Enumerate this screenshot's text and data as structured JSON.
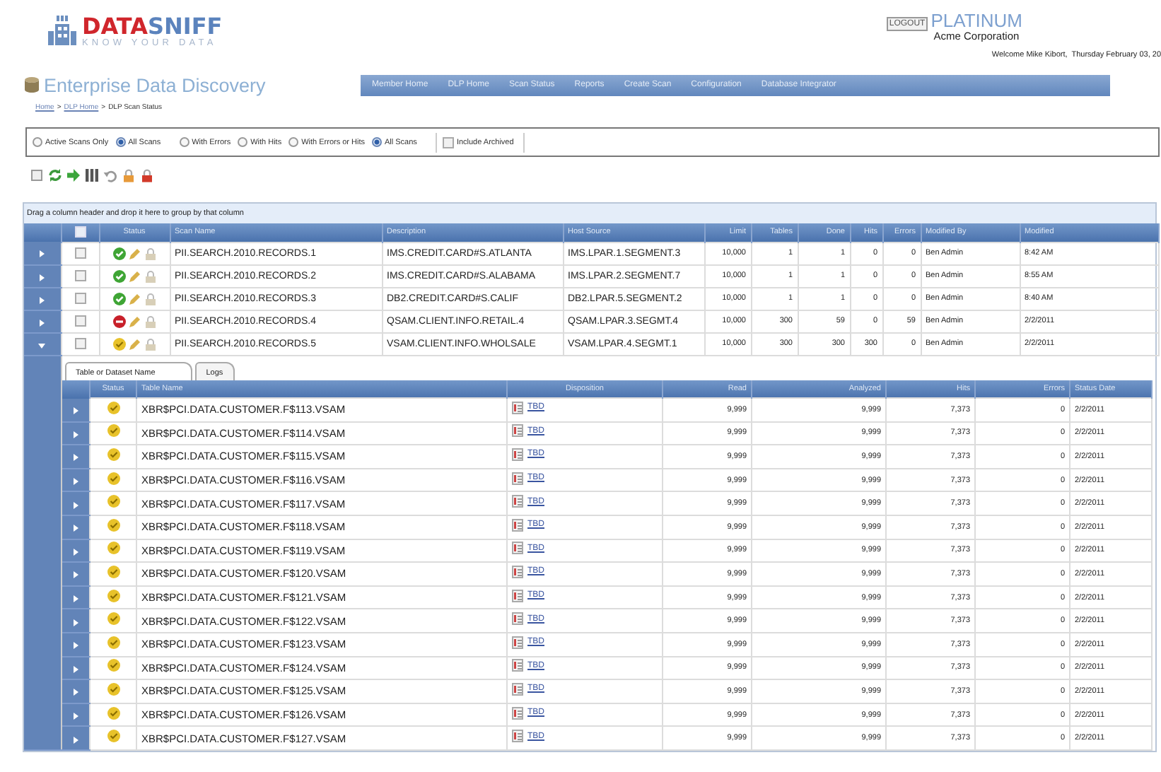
{
  "header": {
    "logo": {
      "word_1": "DATA",
      "word_2": "SNIFF",
      "tagline": "KNOW YOUR DATA"
    },
    "logout": "LOGOUT",
    "plan": "PLATINUM",
    "company": "Acme Corporation",
    "welcome": "Welcome Mike Kibort,  Thursday February 03, 20"
  },
  "app_title": "Enterprise Data Discovery",
  "nav": [
    {
      "label": "Member Home",
      "selected": false
    },
    {
      "label": "DLP Home",
      "selected": false
    },
    {
      "label": "Scan Status",
      "selected": false
    },
    {
      "label": "Reports",
      "selected": false
    },
    {
      "label": "Create Scan",
      "selected": false
    },
    {
      "label": "Configuration",
      "selected": false
    },
    {
      "label": "Database Integrator",
      "selected": false
    }
  ],
  "breadcrumb": [
    {
      "label": "Home",
      "kind": "link"
    },
    {
      "label": ">",
      "kind": "sep"
    },
    {
      "label": "DLP Home",
      "kind": "link"
    },
    {
      "label": ">",
      "kind": "sep"
    },
    {
      "label": "DLP Scan Status",
      "kind": "current"
    }
  ],
  "filters": [
    [
      {
        "label": "Active Scans Only",
        "selected": false
      },
      {
        "label": "All Scans",
        "selected": true
      }
    ],
    [
      {
        "label": "With Errors",
        "selected": false
      },
      {
        "label": "With Hits",
        "selected": false
      },
      {
        "label": "With Errors or Hits",
        "selected": false
      },
      {
        "label": "All Scans",
        "selected": true
      }
    ]
  ],
  "include_archived": {
    "label": "Include Archived",
    "checked": false
  },
  "grid": {
    "group_hint": "Drag a column header and drop it here to group by that column",
    "select_all_checked": false,
    "status_header": "Status",
    "columns": [
      "Scan Name",
      "Description",
      "Host Source",
      "Limit",
      "Tables",
      "Done",
      "Hits",
      "Errors",
      "Modified By",
      "Modified"
    ],
    "rows": [
      {
        "expanded": false,
        "checked": false,
        "kind": "ok",
        "cells": [
          "PII.SEARCH.2010.RECORDS.1",
          "IMS.CREDIT.CARD#S.ATLANTA",
          "IMS.LPAR.1.SEGMENT.3",
          "10,000",
          "1",
          "1",
          "0",
          "0",
          "Ben Admin",
          "8:42 AM"
        ]
      },
      {
        "expanded": false,
        "checked": false,
        "kind": "ok",
        "cells": [
          "PII.SEARCH.2010.RECORDS.2",
          "IMS.CREDIT.CARD#S.ALABAMA",
          "IMS.LPAR.2.SEGMENT.7",
          "10,000",
          "1",
          "1",
          "0",
          "0",
          "Ben Admin",
          "8:55 AM"
        ]
      },
      {
        "expanded": false,
        "checked": false,
        "kind": "ok",
        "cells": [
          "PII.SEARCH.2010.RECORDS.3",
          "DB2.CREDIT.CARD#S.CALIF",
          "DB2.LPAR.5.SEGMENT.2",
          "10,000",
          "1",
          "1",
          "0",
          "0",
          "Ben Admin",
          "8:40 AM"
        ]
      },
      {
        "expanded": false,
        "checked": false,
        "kind": "error",
        "cells": [
          "PII.SEARCH.2010.RECORDS.4",
          "QSAM.CLIENT.INFO.RETAIL.4",
          "QSAM.LPAR.3.SEGMT.4",
          "10,000",
          "300",
          "59",
          "0",
          "59",
          "Ben Admin",
          "2/2/2011"
        ]
      },
      {
        "expanded": true,
        "checked": false,
        "kind": "pending",
        "cells": [
          "PII.SEARCH.2010.RECORDS.5",
          "VSAM.CLIENT.INFO.WHOLSALE",
          "VSAM.LPAR.4.SEGMT.1",
          "10,000",
          "300",
          "300",
          "300",
          "0",
          "Ben Admin",
          "2/2/2011"
        ]
      }
    ]
  },
  "detail": {
    "tabs": [
      {
        "label": "Table or Dataset Name",
        "selected": true
      },
      {
        "label": "Logs",
        "selected": false
      }
    ],
    "status_header": "Status",
    "columns": [
      "Table Name",
      "Disposition",
      "Read",
      "Analyzed",
      "Hits",
      "Errors",
      "Status Date"
    ],
    "rows": [
      {
        "kind": "pending",
        "cells": [
          "XBR$PCI.DATA.CUSTOMER.F$113.VSAM",
          "TBD",
          "9,999",
          "9,999",
          "7,373",
          "0",
          "2/2/2011"
        ]
      },
      {
        "kind": "pending",
        "cells": [
          "XBR$PCI.DATA.CUSTOMER.F$114.VSAM",
          "TBD",
          "9,999",
          "9,999",
          "7,373",
          "0",
          "2/2/2011"
        ]
      },
      {
        "kind": "pending",
        "cells": [
          "XBR$PCI.DATA.CUSTOMER.F$115.VSAM",
          "TBD",
          "9,999",
          "9,999",
          "7,373",
          "0",
          "2/2/2011"
        ]
      },
      {
        "kind": "pending",
        "cells": [
          "XBR$PCI.DATA.CUSTOMER.F$116.VSAM",
          "TBD",
          "9,999",
          "9,999",
          "7,373",
          "0",
          "2/2/2011"
        ]
      },
      {
        "kind": "pending",
        "cells": [
          "XBR$PCI.DATA.CUSTOMER.F$117.VSAM",
          "TBD",
          "9,999",
          "9,999",
          "7,373",
          "0",
          "2/2/2011"
        ]
      },
      {
        "kind": "pending",
        "cells": [
          "XBR$PCI.DATA.CUSTOMER.F$118.VSAM",
          "TBD",
          "9,999",
          "9,999",
          "7,373",
          "0",
          "2/2/2011"
        ]
      },
      {
        "kind": "pending",
        "cells": [
          "XBR$PCI.DATA.CUSTOMER.F$119.VSAM",
          "TBD",
          "9,999",
          "9,999",
          "7,373",
          "0",
          "2/2/2011"
        ]
      },
      {
        "kind": "pending",
        "cells": [
          "XBR$PCI.DATA.CUSTOMER.F$120.VSAM",
          "TBD",
          "9,999",
          "9,999",
          "7,373",
          "0",
          "2/2/2011"
        ]
      },
      {
        "kind": "pending",
        "cells": [
          "XBR$PCI.DATA.CUSTOMER.F$121.VSAM",
          "TBD",
          "9,999",
          "9,999",
          "7,373",
          "0",
          "2/2/2011"
        ]
      },
      {
        "kind": "pending",
        "cells": [
          "XBR$PCI.DATA.CUSTOMER.F$122.VSAM",
          "TBD",
          "9,999",
          "9,999",
          "7,373",
          "0",
          "2/2/2011"
        ]
      },
      {
        "kind": "pending",
        "cells": [
          "XBR$PCI.DATA.CUSTOMER.F$123.VSAM",
          "TBD",
          "9,999",
          "9,999",
          "7,373",
          "0",
          "2/2/2011"
        ]
      },
      {
        "kind": "pending",
        "cells": [
          "XBR$PCI.DATA.CUSTOMER.F$124.VSAM",
          "TBD",
          "9,999",
          "9,999",
          "7,373",
          "0",
          "2/2/2011"
        ]
      },
      {
        "kind": "pending",
        "cells": [
          "XBR$PCI.DATA.CUSTOMER.F$125.VSAM",
          "TBD",
          "9,999",
          "9,999",
          "7,373",
          "0",
          "2/2/2011"
        ]
      },
      {
        "kind": "pending",
        "cells": [
          "XBR$PCI.DATA.CUSTOMER.F$126.VSAM",
          "TBD",
          "9,999",
          "9,999",
          "7,373",
          "0",
          "2/2/2011"
        ]
      },
      {
        "kind": "pending",
        "cells": [
          "XBR$PCI.DATA.CUSTOMER.F$127.VSAM",
          "TBD",
          "9,999",
          "9,999",
          "7,373",
          "0",
          "2/2/2011"
        ]
      }
    ]
  }
}
